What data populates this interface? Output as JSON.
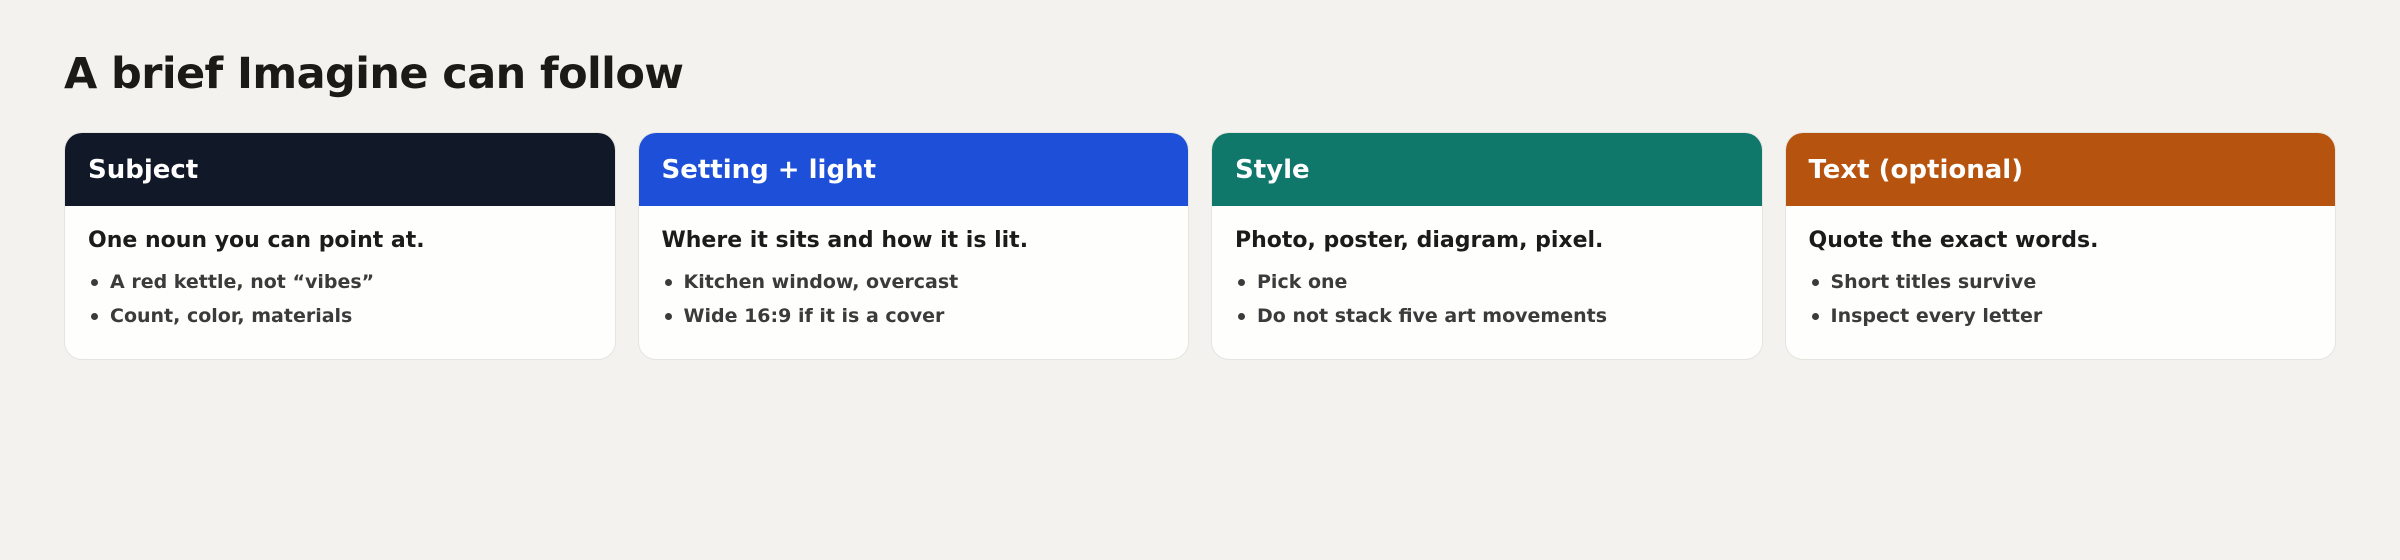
{
  "page": {
    "title": "A brief Imagine can follow"
  },
  "cards": [
    {
      "title": "Subject",
      "header_color": "#111827",
      "lead": "One noun you can point at.",
      "bullets": [
        "A red kettle, not “vibes”",
        "Count, color, materials"
      ]
    },
    {
      "title": "Setting + light",
      "header_color": "#1d4fd8",
      "lead": "Where it sits and how it is lit.",
      "bullets": [
        "Kitchen window, overcast",
        "Wide 16:9 if it is a cover"
      ]
    },
    {
      "title": "Style",
      "header_color": "#10776b",
      "lead": "Photo, poster, diagram, pixel.",
      "bullets": [
        "Pick one",
        "Do not stack five art movements"
      ]
    },
    {
      "title": "Text (optional)",
      "header_color": "#b6530e",
      "lead": "Quote the exact words.",
      "bullets": [
        "Short titles survive",
        "Inspect every letter"
      ]
    }
  ]
}
